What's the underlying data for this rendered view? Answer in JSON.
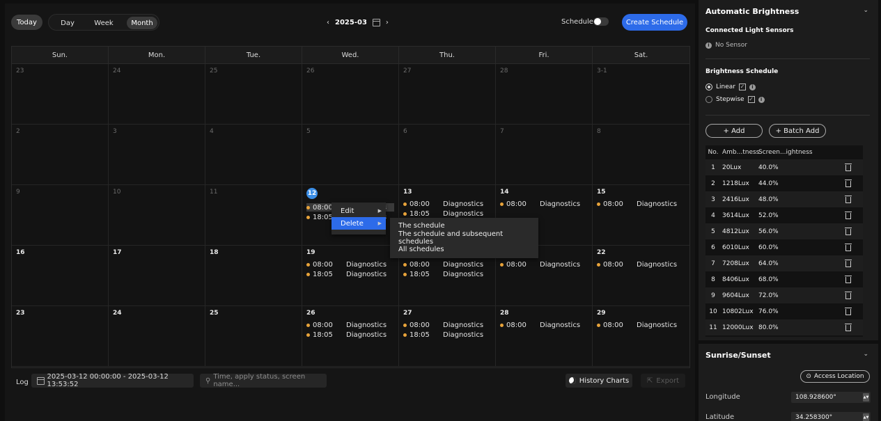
{
  "toolbar": {
    "today": "Today",
    "views": [
      "Day",
      "Week",
      "Month"
    ],
    "active_view": "Month",
    "prev": "‹",
    "month": "2025-03",
    "next": "›",
    "schedule_label": "Schedule",
    "create": "Create Schedule"
  },
  "weekdays": [
    "Sun.",
    "Mon.",
    "Tue.",
    "Wed.",
    "Thu.",
    "Fri.",
    "Sat."
  ],
  "weeks": [
    [
      {
        "d": "23",
        "cur": false
      },
      {
        "d": "24",
        "cur": false
      },
      {
        "d": "25",
        "cur": false
      },
      {
        "d": "26",
        "cur": false
      },
      {
        "d": "27",
        "cur": false
      },
      {
        "d": "28",
        "cur": false
      },
      {
        "d": "3-1",
        "cur": false
      }
    ],
    [
      {
        "d": "2",
        "cur": false
      },
      {
        "d": "3",
        "cur": false
      },
      {
        "d": "4",
        "cur": false
      },
      {
        "d": "5",
        "cur": false
      },
      {
        "d": "6",
        "cur": false
      },
      {
        "d": "7",
        "cur": false
      },
      {
        "d": "8",
        "cur": false
      }
    ],
    [
      {
        "d": "9",
        "cur": false
      },
      {
        "d": "10",
        "cur": false
      },
      {
        "d": "11",
        "cur": false
      },
      {
        "d": "12",
        "cur": true,
        "today": true,
        "events": [
          {
            "time": "08:00",
            "name": "Diagnostics",
            "sel": true
          },
          {
            "time": "18:05",
            "name": "Diagnostics"
          }
        ]
      },
      {
        "d": "13",
        "cur": true,
        "events": [
          {
            "time": "08:00",
            "name": "Diagnostics"
          },
          {
            "time": "18:05",
            "name": "Diagnostics"
          }
        ]
      },
      {
        "d": "14",
        "cur": true,
        "events": [
          {
            "time": "08:00",
            "name": "Diagnostics"
          }
        ]
      },
      {
        "d": "15",
        "cur": true,
        "events": [
          {
            "time": "08:00",
            "name": "Diagnostics"
          }
        ]
      }
    ],
    [
      {
        "d": "16",
        "cur": true
      },
      {
        "d": "17",
        "cur": true
      },
      {
        "d": "18",
        "cur": true
      },
      {
        "d": "19",
        "cur": true,
        "events": [
          {
            "time": "08:00",
            "name": "Diagnostics"
          },
          {
            "time": "18:05",
            "name": "Diagnostics"
          }
        ]
      },
      {
        "d": "20",
        "cur": true,
        "events": [
          {
            "time": "08:00",
            "name": "Diagnostics"
          },
          {
            "time": "18:05",
            "name": "Diagnostics"
          }
        ]
      },
      {
        "d": "21",
        "cur": true,
        "events": [
          {
            "time": "08:00",
            "name": "Diagnostics"
          }
        ]
      },
      {
        "d": "22",
        "cur": true,
        "events": [
          {
            "time": "08:00",
            "name": "Diagnostics"
          }
        ]
      }
    ],
    [
      {
        "d": "23",
        "cur": true
      },
      {
        "d": "24",
        "cur": true
      },
      {
        "d": "25",
        "cur": true
      },
      {
        "d": "26",
        "cur": true,
        "events": [
          {
            "time": "08:00",
            "name": "Diagnostics"
          },
          {
            "time": "18:05",
            "name": "Diagnostics"
          }
        ]
      },
      {
        "d": "27",
        "cur": true,
        "events": [
          {
            "time": "08:00",
            "name": "Diagnostics"
          },
          {
            "time": "18:05",
            "name": "Diagnostics"
          }
        ]
      },
      {
        "d": "28",
        "cur": true,
        "events": [
          {
            "time": "08:00",
            "name": "Diagnostics"
          }
        ]
      },
      {
        "d": "29",
        "cur": true,
        "events": [
          {
            "time": "08:00",
            "name": "Diagnostics"
          }
        ]
      }
    ]
  ],
  "context_menu": {
    "items": [
      "Edit",
      "Delete"
    ],
    "active": "Delete"
  },
  "delete_submenu": [
    "The schedule",
    "The schedule and subsequent schedules",
    "All schedules"
  ],
  "log": {
    "label": "Log",
    "range": "2025-03-12 00:00:00  - 2025-03-12 13:53:52",
    "search_placeholder": "Time, apply status, screen name...",
    "history": "History Charts",
    "export": "Export"
  },
  "panel": {
    "title": "Automatic Brightness",
    "sensors_title": "Connected Light Sensors",
    "no_sensor": "No Sensor",
    "schedule_title": "Brightness Schedule",
    "linear": "Linear",
    "stepwise": "Stepwise",
    "add": "+ Add",
    "batch_add": "+ Batch Add",
    "headers": [
      "No.",
      "Amb...tness",
      "Screen...ightness"
    ],
    "rows": [
      [
        "1",
        "20Lux",
        "40.0%"
      ],
      [
        "2",
        "1218Lux",
        "44.0%"
      ],
      [
        "3",
        "2416Lux",
        "48.0%"
      ],
      [
        "4",
        "3614Lux",
        "52.0%"
      ],
      [
        "5",
        "4812Lux",
        "56.0%"
      ],
      [
        "6",
        "6010Lux",
        "60.0%"
      ],
      [
        "7",
        "7208Lux",
        "64.0%"
      ],
      [
        "8",
        "8406Lux",
        "68.0%"
      ],
      [
        "9",
        "9604Lux",
        "72.0%"
      ],
      [
        "10",
        "10802Lux",
        "76.0%"
      ],
      [
        "11",
        "12000Lux",
        "80.0%"
      ]
    ]
  },
  "sun": {
    "title": "Sunrise/Sunset",
    "access": "Access Location",
    "longitude_label": "Longitude",
    "longitude": "108.928600°",
    "latitude_label": "Latitude",
    "latitude": "34.258300°"
  },
  "colors": {
    "accent": "#2d6be9",
    "event_dot": "#e8a33a",
    "today": "#3b8ee6"
  }
}
